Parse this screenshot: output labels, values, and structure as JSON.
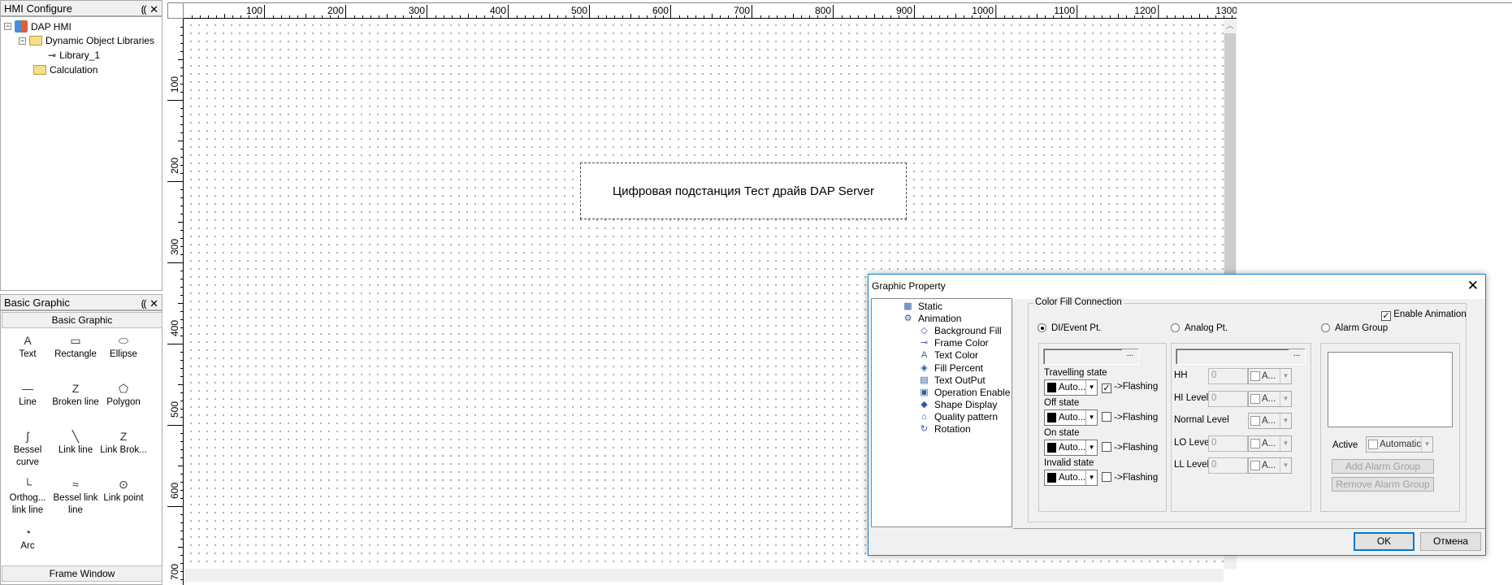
{
  "hmi_panel": {
    "title": "HMI Configure",
    "pin": "⸨",
    "close": "✕",
    "tree": [
      {
        "label": "DAP HMI",
        "level": 0
      },
      {
        "label": "Dynamic Object Libraries",
        "level": 1
      },
      {
        "label": "Library_1",
        "level": 2
      },
      {
        "label": "Calculation",
        "level": 1
      }
    ]
  },
  "basic_panel": {
    "title": "Basic Graphic",
    "section": "Basic Graphic",
    "footer": "Frame Window",
    "tools": [
      {
        "label": "Text",
        "icon": "A"
      },
      {
        "label": "Rectangle",
        "icon": "▭"
      },
      {
        "label": "Ellipse",
        "icon": "⬭"
      },
      {
        "label": "Line",
        "icon": "—"
      },
      {
        "label": "Broken line",
        "icon": "Z"
      },
      {
        "label": "Polygon",
        "icon": "⬠"
      },
      {
        "label": "Bessel curve",
        "icon": "∫"
      },
      {
        "label": "Link line",
        "icon": "╲"
      },
      {
        "label": "Link Brok...",
        "icon": "Z"
      },
      {
        "label": "Orthog... link line",
        "icon": "└"
      },
      {
        "label": "Bessel link line",
        "icon": "≈"
      },
      {
        "label": "Link point",
        "icon": "⊙"
      },
      {
        "label": "Arc",
        "icon": "◔"
      }
    ]
  },
  "ruler": {
    "x_labels": [
      "100",
      "200",
      "300",
      "400",
      "500",
      "600",
      "700",
      "800",
      "900",
      "1000",
      "1100",
      "1200",
      "1300"
    ],
    "y_labels": [
      "100",
      "200",
      "300",
      "400",
      "500",
      "600",
      "700"
    ]
  },
  "canvas": {
    "text_object": "Цифровая подстанция Тест драйв DAP Server"
  },
  "dialog": {
    "title": "Graphic Property",
    "close": "✕",
    "tree": [
      {
        "label": "Static",
        "level": 0,
        "icon": "▦"
      },
      {
        "label": "Animation",
        "level": 0,
        "icon": "⚙"
      },
      {
        "label": "Background Fill",
        "level": 1,
        "icon": "◇"
      },
      {
        "label": "Frame Color",
        "level": 1,
        "icon": "⊸"
      },
      {
        "label": "Text Color",
        "level": 1,
        "icon": "A"
      },
      {
        "label": "Fill Percent",
        "level": 1,
        "icon": "◈"
      },
      {
        "label": "Text OutPut",
        "level": 1,
        "icon": "▤"
      },
      {
        "label": "Operation Enable",
        "level": 1,
        "icon": "▣"
      },
      {
        "label": "Shape Display",
        "level": 1,
        "icon": "◆"
      },
      {
        "label": "Quality pattern",
        "level": 1,
        "icon": "⌂"
      },
      {
        "label": "Rotation",
        "level": 1,
        "icon": "↻"
      }
    ],
    "group_title": "Color Fill Connection",
    "enable_animation": {
      "label": "Enable Animation",
      "checked": true
    },
    "radios": [
      {
        "label": "DI/Event Pt.",
        "selected": true
      },
      {
        "label": "Analog Pt.",
        "selected": false
      },
      {
        "label": "Alarm Group",
        "selected": false
      }
    ],
    "di": {
      "browse": "...",
      "states": [
        {
          "label": "Travelling state",
          "color": "Auto...",
          "flashing": true
        },
        {
          "label": "Off state",
          "color": "Auto...",
          "flashing": false
        },
        {
          "label": "On state",
          "color": "Auto...",
          "flashing": false
        },
        {
          "label": "Invalid state",
          "color": "Auto...",
          "flashing": false
        }
      ],
      "flashing_label": "->Flashing"
    },
    "analog": {
      "browse": "...",
      "levels": [
        {
          "label": "HH",
          "value": "0",
          "combo": "A..."
        },
        {
          "label": "HI Level",
          "value": "0",
          "combo": "A..."
        },
        {
          "label": "Normal Level",
          "value": null,
          "combo": "A..."
        },
        {
          "label": "LO Level",
          "value": "0",
          "combo": "A..."
        },
        {
          "label": "LL Level",
          "value": "0",
          "combo": "A..."
        }
      ]
    },
    "alarm": {
      "active_label": "Active",
      "active_value": "Automatic",
      "add": "Add Alarm Group",
      "remove": "Remove Alarm Group"
    },
    "ok": "OK",
    "cancel": "Отмена"
  }
}
